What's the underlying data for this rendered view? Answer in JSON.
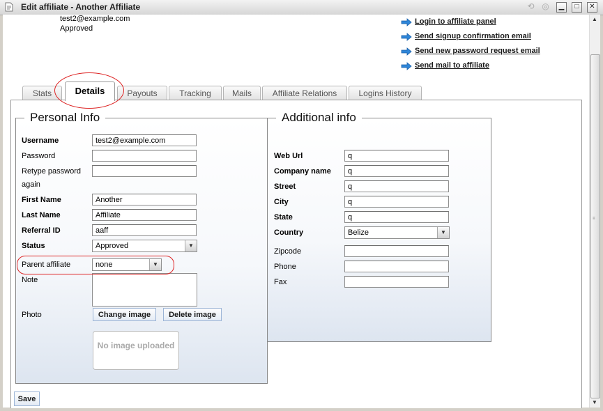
{
  "window": {
    "title": "Edit affiliate - Another Affiliate",
    "controls": [
      "⟲",
      "◎",
      "✕"
    ]
  },
  "header": {
    "email": "test2@example.com",
    "status": "Approved"
  },
  "actions": [
    "Login to affiliate panel",
    "Send signup confirmation email",
    "Send new password request email",
    "Send mail to affiliate"
  ],
  "tabs": [
    "Stats",
    "Details",
    "Payouts",
    "Tracking",
    "Mails",
    "Affiliate Relations",
    "Logins History"
  ],
  "personal": {
    "legend": "Personal Info",
    "username_label": "Username",
    "username": "test2@example.com",
    "password_label": "Password",
    "password": "",
    "retype_label": "Retype password",
    "retype_label2": "again",
    "retype": "",
    "first_name_label": "First Name",
    "first_name": "Another",
    "last_name_label": "Last Name",
    "last_name": "Affiliate",
    "referral_label": "Referral ID",
    "referral": "aaff",
    "status_label": "Status",
    "status": "Approved",
    "parent_label": "Parent affiliate",
    "parent": "none",
    "note_label": "Note",
    "photo_label": "Photo",
    "change_image": "Change image",
    "delete_image": "Delete image",
    "no_image": "No image uploaded"
  },
  "additional": {
    "legend": "Additional info",
    "weburl_label": "Web Url",
    "weburl": "q",
    "company_label": "Company name",
    "company": "q",
    "street_label": "Street",
    "street": "q",
    "city_label": "City",
    "city": "q",
    "state_label": "State",
    "state": "q",
    "country_label": "Country",
    "country": "Belize",
    "zipcode_label": "Zipcode",
    "zipcode": "",
    "phone_label": "Phone",
    "phone": "",
    "fax_label": "Fax",
    "fax": ""
  },
  "footer": {
    "save": "Save"
  },
  "colors": {
    "highlight": "#dd2222",
    "action_arrow": "#2e86d9"
  },
  "icons": {
    "action": "arrow-right-icon",
    "dropdown": "chevron-down-icon"
  }
}
